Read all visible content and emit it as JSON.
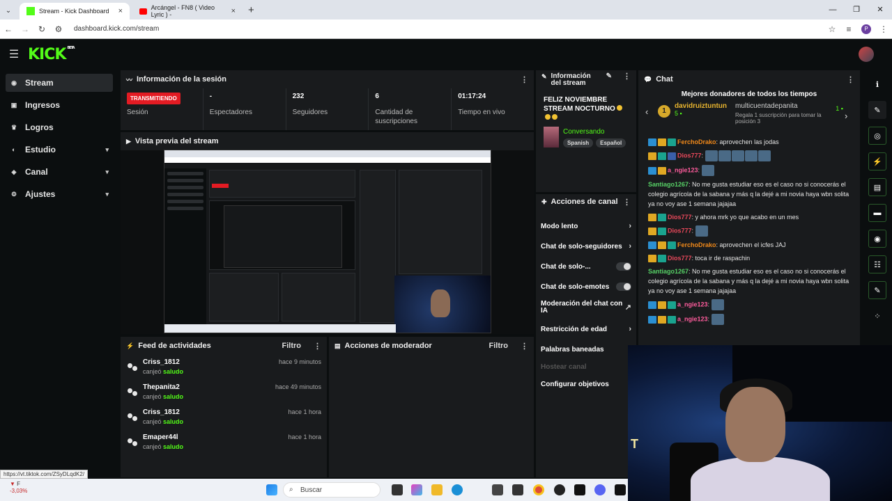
{
  "browser": {
    "tabs": [
      {
        "title": "Stream - Kick Dashboard",
        "active": true
      },
      {
        "title": "Arcángel - FN8 ( Video Lyric ) -",
        "active": false
      }
    ],
    "url": "dashboard.kick.com/stream",
    "profile_initial": "P",
    "status_url": "https://vt.tiktok.com/ZSyDLqdK2/"
  },
  "kick": {
    "logo": "KICK",
    "beta": "BETA"
  },
  "sidebar": {
    "items": [
      {
        "label": "Stream",
        "icon": "dot-icon"
      },
      {
        "label": "Ingresos",
        "icon": "money-icon"
      },
      {
        "label": "Logros",
        "icon": "trophy-icon"
      },
      {
        "label": "Estudio",
        "icon": "studio-icon"
      },
      {
        "label": "Canal",
        "icon": "channel-icon"
      },
      {
        "label": "Ajustes",
        "icon": "gear-icon"
      }
    ]
  },
  "session": {
    "title": "Información de la sesión",
    "live_badge": "TRANSMITIENDO",
    "stats": [
      {
        "value": "",
        "label": "Sesión"
      },
      {
        "value": "-",
        "label": "Espectadores"
      },
      {
        "value": "232",
        "label": "Seguidores"
      },
      {
        "value": "6",
        "label": "Cantidad de suscripciones"
      },
      {
        "value": "01:17:24",
        "label": "Tiempo en vivo"
      }
    ]
  },
  "preview": {
    "title": "Vista previa del stream"
  },
  "feed": {
    "title": "Feed de actividades",
    "filter": "Filtro",
    "items": [
      {
        "name": "Criss_1812",
        "action": "canjeó",
        "reward": "saludo",
        "time": "hace 9 minutos"
      },
      {
        "name": "Thepanita2",
        "action": "canjeó",
        "reward": "saludo",
        "time": "hace 49 minutos"
      },
      {
        "name": "Criss_1812",
        "action": "canjeó",
        "reward": "saludo",
        "time": "hace 1 hora"
      },
      {
        "name": "Emaper44l",
        "action": "canjeó",
        "reward": "saludo",
        "time": "hace 1 hora"
      }
    ]
  },
  "moderator": {
    "title": "Acciones de moderador",
    "filter": "Filtro"
  },
  "stream_info": {
    "title": "Información del stream",
    "stream_title": "FELIZ NOVIEMBRE STREAM NOCTURNO",
    "category": "Conversando",
    "tags": [
      "Spanish",
      "Español"
    ]
  },
  "channel_actions": {
    "title": "Acciones de canal",
    "items": [
      {
        "label": "Modo lento",
        "kind": "arrow"
      },
      {
        "label": "Chat de solo-seguidores",
        "kind": "arrow"
      },
      {
        "label": "Chat de solo-...",
        "kind": "toggle"
      },
      {
        "label": "Chat de solo-emotes",
        "kind": "toggle"
      },
      {
        "label": "Moderación del chat con IA",
        "kind": "external"
      },
      {
        "label": "Restricción de edad",
        "kind": "arrow"
      },
      {
        "label": "Palabras baneadas",
        "kind": "none"
      },
      {
        "label": "Hostear canal",
        "kind": "disabled"
      },
      {
        "label": "Configurar objetivos",
        "kind": "none"
      }
    ]
  },
  "chat": {
    "title": "Chat",
    "donors_title": "Mejores donadores de todos los tiempos",
    "top_donor": {
      "rank": "1",
      "name": "davidruiztuntun",
      "count": "5"
    },
    "second_donor": {
      "name": "multicuentadepanita",
      "note": "Regala 1 suscripción para tomar la posición 3",
      "count": "1"
    },
    "messages": [
      {
        "user": "FerchoDrako",
        "color": "orange",
        "badges": [
          "b",
          "y",
          "g"
        ],
        "text": "aprovechen las jodas",
        "emotes": 0
      },
      {
        "user": "Dios777",
        "color": "red",
        "badges": [
          "y",
          "g",
          "s"
        ],
        "text": "",
        "emotes": 5
      },
      {
        "user": "a_ngie123",
        "color": "pink",
        "badges": [
          "b",
          "y"
        ],
        "text": "",
        "emotes": 1
      },
      {
        "user": "Santiago1267",
        "color": "green",
        "badges": [],
        "text": "No me gusta estudiar eso es el caso no si conocerás el colegio agrícola de la sabana y más q la dejé a mi novia haya wbn solita ya no voy ase 1 semana jajajaa",
        "emotes": 0
      },
      {
        "user": "Dios777",
        "color": "red",
        "badges": [
          "y",
          "g"
        ],
        "text": "y ahora mrk yo que acabo en un mes",
        "emotes": 0
      },
      {
        "user": "Dios777",
        "color": "red",
        "badges": [
          "y",
          "g"
        ],
        "text": "",
        "emotes": 1
      },
      {
        "user": "FerchoDrako",
        "color": "orange",
        "badges": [
          "b",
          "y",
          "g"
        ],
        "text": "aprovechen el icfes JAJ",
        "emotes": 0
      },
      {
        "user": "Dios777",
        "color": "red",
        "badges": [
          "y",
          "g"
        ],
        "text": "toca ir de raspachin",
        "emotes": 0
      },
      {
        "user": "Santiago1267",
        "color": "green",
        "badges": [],
        "text": "No me gusta estudiar eso es el caso no si conocerás el colegio agrícola de la sabana y más q la dejé a mi novia haya wbn solita ya no voy ase 1 semana jajajaa",
        "emotes": 0
      },
      {
        "user": "a_ngie123",
        "color": "pink",
        "badges": [
          "b",
          "y",
          "g"
        ],
        "text": "",
        "emotes": 1
      },
      {
        "user": "a_ngie123",
        "color": "pink",
        "badges": [
          "b",
          "y",
          "g"
        ],
        "text": "",
        "emotes": 1
      }
    ]
  },
  "taskbar": {
    "ticker": "F",
    "change": "-3,03%",
    "search_placeholder": "Buscar"
  },
  "colors": {
    "accent": "#53fc18",
    "live": "#e31b23",
    "panel": "#191b1d",
    "bg": "#0b0e0f"
  }
}
